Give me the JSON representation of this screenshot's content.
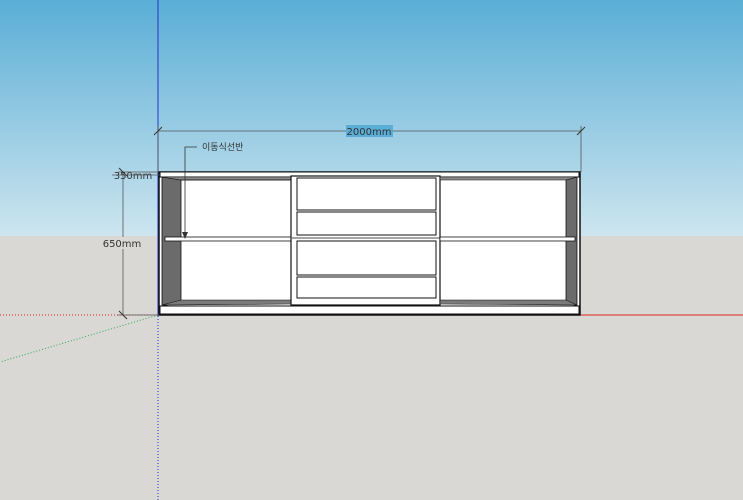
{
  "app": {
    "name": "SketchUp model viewport"
  },
  "colors": {
    "sky_top": "#5aaed6",
    "sky_bottom": "#cde5ef",
    "ground": "#d9d8d4",
    "axis_blue": "#2233cc",
    "axis_red": "#dd2222",
    "axis_green": "#33aa55",
    "edge": "#111111",
    "side_panel": "#6b6b6b",
    "face": "#ffffff"
  },
  "dimensions": {
    "width_label": "2000mm",
    "height_label": "650mm",
    "depth_label": "350mm"
  },
  "annotations": {
    "shelf_note": "이동식선반"
  },
  "cabinet": {
    "left_section": {
      "shelves": 1
    },
    "center_section": {
      "drawers": 4
    },
    "right_section": {
      "shelves": 1
    }
  }
}
